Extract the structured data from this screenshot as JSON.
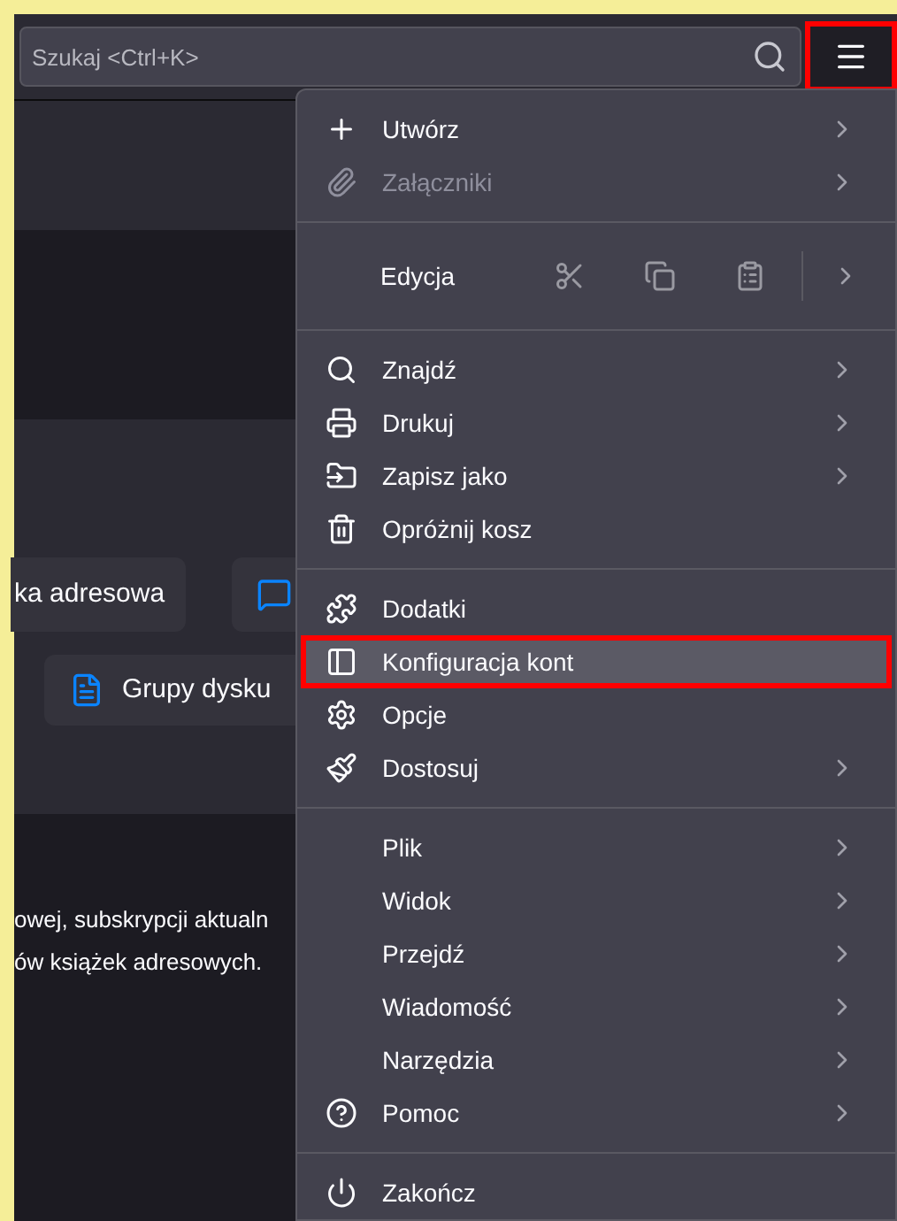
{
  "toolbar": {
    "search": {
      "placeholder": "Szukaj <Ctrl+K>"
    },
    "menu_button": {
      "annotated": true,
      "expanded": true
    }
  },
  "background": {
    "buttons": [
      {
        "label": "ka adresowa"
      },
      {
        "kind": "icon"
      },
      {
        "label": "Grupy dysku"
      }
    ],
    "text_lines": [
      "owej, subskrypcji aktualn",
      "ów książek adresowych."
    ]
  },
  "menu": {
    "sections": [
      [
        {
          "kind": "item",
          "label": "Utwórz",
          "submenu": true,
          "disabled": false,
          "selected": false,
          "annotated": false
        },
        {
          "kind": "item",
          "label": "Załączniki",
          "submenu": true,
          "disabled": true,
          "selected": false,
          "annotated": false
        }
      ],
      [
        {
          "kind": "edit",
          "label": "Edycja",
          "submenu": true,
          "disabled": false,
          "selected": false,
          "annotated": false
        }
      ],
      [
        {
          "kind": "item",
          "label": "Znajdź",
          "submenu": true,
          "disabled": false,
          "selected": false,
          "annotated": false
        },
        {
          "kind": "item",
          "label": "Drukuj",
          "submenu": true,
          "disabled": false,
          "selected": false,
          "annotated": false
        },
        {
          "kind": "item",
          "label": "Zapisz jako",
          "submenu": true,
          "disabled": false,
          "selected": false,
          "annotated": false
        },
        {
          "kind": "item",
          "label": "Opróżnij kosz",
          "submenu": false,
          "disabled": false,
          "selected": false,
          "annotated": false
        }
      ],
      [
        {
          "kind": "item",
          "label": "Dodatki",
          "submenu": false,
          "disabled": false,
          "selected": false,
          "annotated": false
        },
        {
          "kind": "item",
          "label": "Konfiguracja kont",
          "submenu": false,
          "disabled": false,
          "selected": true,
          "annotated": true
        },
        {
          "kind": "item",
          "label": "Opcje",
          "submenu": false,
          "disabled": false,
          "selected": false,
          "annotated": false
        },
        {
          "kind": "item",
          "label": "Dostosuj",
          "submenu": true,
          "disabled": false,
          "selected": false,
          "annotated": false
        }
      ],
      [
        {
          "kind": "item",
          "label": "Plik",
          "submenu": true,
          "disabled": false,
          "selected": false,
          "annotated": false
        },
        {
          "kind": "item",
          "label": "Widok",
          "submenu": true,
          "disabled": false,
          "selected": false,
          "annotated": false
        },
        {
          "kind": "item",
          "label": "Przejdź",
          "submenu": true,
          "disabled": false,
          "selected": false,
          "annotated": false
        },
        {
          "kind": "item",
          "label": "Wiadomość",
          "submenu": true,
          "disabled": false,
          "selected": false,
          "annotated": false
        },
        {
          "kind": "item",
          "label": "Narzędzia",
          "submenu": true,
          "disabled": false,
          "selected": false,
          "annotated": false
        },
        {
          "kind": "item",
          "label": "Pomoc",
          "submenu": true,
          "disabled": false,
          "selected": false,
          "annotated": false
        }
      ],
      [
        {
          "kind": "item",
          "label": "Zakończ",
          "submenu": false,
          "disabled": false,
          "selected": false,
          "annotated": false
        }
      ]
    ]
  }
}
